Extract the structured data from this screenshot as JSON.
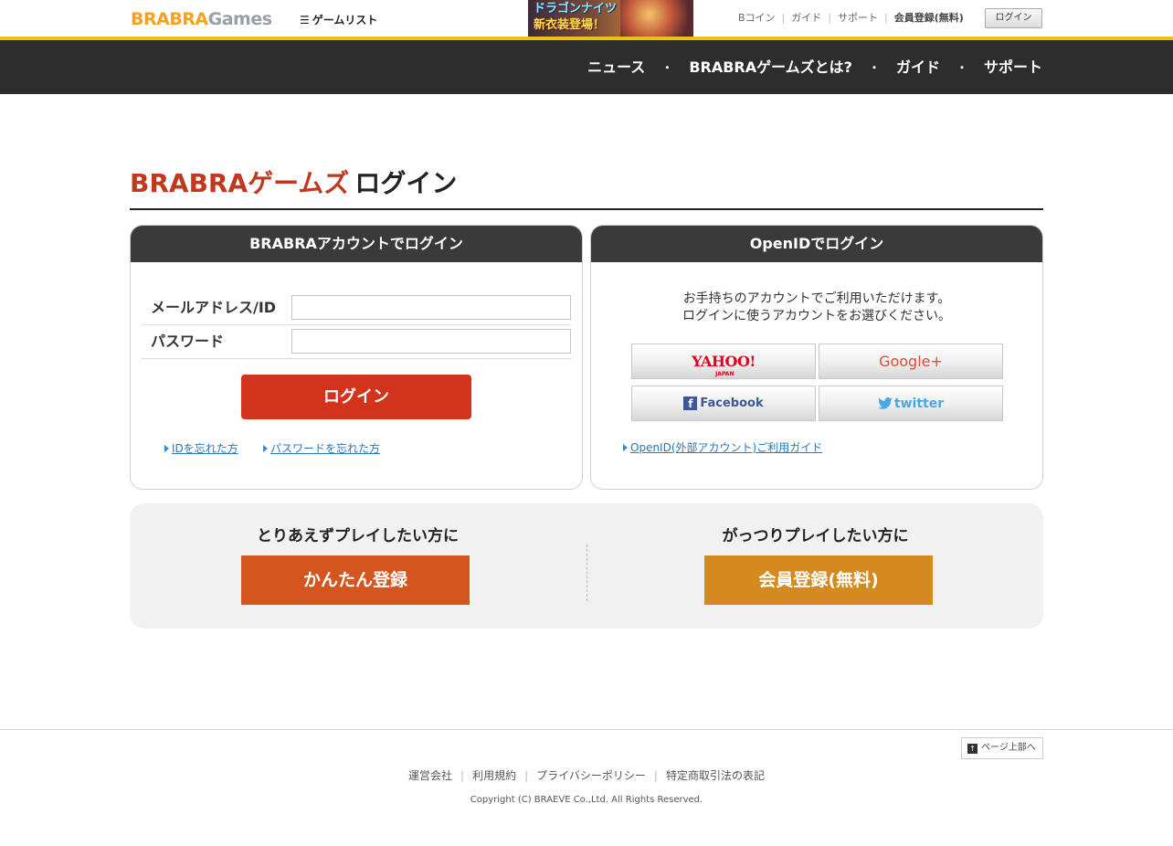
{
  "header": {
    "logo_part1": "BRABRA",
    "logo_part2": "Games",
    "game_list_label": "ゲームリスト",
    "banner_line1": "ドラゴンナイツ",
    "banner_line2": "新衣装登場！",
    "top_links": [
      "Bコイン",
      "ガイド",
      "サポート"
    ],
    "register_label": "会員登録(無料)",
    "login_button": "ログイン"
  },
  "nav": {
    "items": [
      "ニュース",
      "BRABRAゲームズとは?",
      "ガイド",
      "サポート"
    ],
    "separator": "・"
  },
  "page": {
    "title_brand": "BRABRAゲームズ",
    "title_rest": "ログイン"
  },
  "account_panel": {
    "title": "BRABRAアカウントでログイン",
    "email_label": "メールアドレス/ID",
    "email_value": "",
    "password_label": "パスワード",
    "password_value": "",
    "login_button": "ログイン",
    "forgot_id": "IDを忘れた方",
    "forgot_password": "パスワードを忘れた方"
  },
  "openid_panel": {
    "title": "OpenIDでログイン",
    "desc_line1": "お手持ちのアカウントでご利用いただけます。",
    "desc_line2": "ログインに使うアカウントをお選びください。",
    "yahoo": "YAHOO!",
    "yahoo_sub": "JAPAN",
    "google": "Google+",
    "facebook": "Facebook",
    "twitter": "twitter",
    "guide_link": "OpenID(外部アカウント)ご利用ガイド"
  },
  "register": {
    "left_title": "とりあえずプレイしたい方に",
    "left_button": "かんたん登録",
    "right_title": "がっつりプレイしたい方に",
    "right_button": "会員登録(無料)"
  },
  "footer": {
    "page_top": "ページ上部へ",
    "links": [
      "運営会社",
      "利用規約",
      "プライバシーポリシー",
      "特定商取引法の表記"
    ],
    "copyright": "Copyright (C) BRAEVE Co.,Ltd. All Rights Reserved."
  },
  "colors": {
    "accent_yellow": "#f0be1a",
    "nav_bg": "#2d2d2d",
    "brand_red": "#c0391e",
    "login_red": "#d2341b",
    "easy_orange": "#d4551f",
    "member_orange": "#d48a1e"
  }
}
